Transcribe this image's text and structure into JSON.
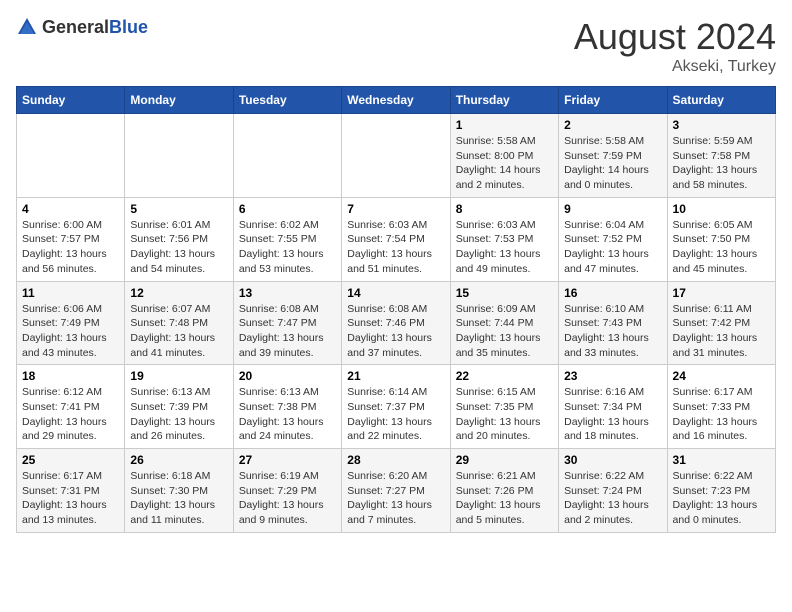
{
  "header": {
    "logo_general": "General",
    "logo_blue": "Blue",
    "main_title": "August 2024",
    "sub_title": "Akseki, Turkey"
  },
  "weekdays": [
    "Sunday",
    "Monday",
    "Tuesday",
    "Wednesday",
    "Thursday",
    "Friday",
    "Saturday"
  ],
  "weeks": [
    [
      {
        "day": "",
        "info": ""
      },
      {
        "day": "",
        "info": ""
      },
      {
        "day": "",
        "info": ""
      },
      {
        "day": "",
        "info": ""
      },
      {
        "day": "1",
        "info": "Sunrise: 5:58 AM\nSunset: 8:00 PM\nDaylight: 14 hours\nand 2 minutes."
      },
      {
        "day": "2",
        "info": "Sunrise: 5:58 AM\nSunset: 7:59 PM\nDaylight: 14 hours\nand 0 minutes."
      },
      {
        "day": "3",
        "info": "Sunrise: 5:59 AM\nSunset: 7:58 PM\nDaylight: 13 hours\nand 58 minutes."
      }
    ],
    [
      {
        "day": "4",
        "info": "Sunrise: 6:00 AM\nSunset: 7:57 PM\nDaylight: 13 hours\nand 56 minutes."
      },
      {
        "day": "5",
        "info": "Sunrise: 6:01 AM\nSunset: 7:56 PM\nDaylight: 13 hours\nand 54 minutes."
      },
      {
        "day": "6",
        "info": "Sunrise: 6:02 AM\nSunset: 7:55 PM\nDaylight: 13 hours\nand 53 minutes."
      },
      {
        "day": "7",
        "info": "Sunrise: 6:03 AM\nSunset: 7:54 PM\nDaylight: 13 hours\nand 51 minutes."
      },
      {
        "day": "8",
        "info": "Sunrise: 6:03 AM\nSunset: 7:53 PM\nDaylight: 13 hours\nand 49 minutes."
      },
      {
        "day": "9",
        "info": "Sunrise: 6:04 AM\nSunset: 7:52 PM\nDaylight: 13 hours\nand 47 minutes."
      },
      {
        "day": "10",
        "info": "Sunrise: 6:05 AM\nSunset: 7:50 PM\nDaylight: 13 hours\nand 45 minutes."
      }
    ],
    [
      {
        "day": "11",
        "info": "Sunrise: 6:06 AM\nSunset: 7:49 PM\nDaylight: 13 hours\nand 43 minutes."
      },
      {
        "day": "12",
        "info": "Sunrise: 6:07 AM\nSunset: 7:48 PM\nDaylight: 13 hours\nand 41 minutes."
      },
      {
        "day": "13",
        "info": "Sunrise: 6:08 AM\nSunset: 7:47 PM\nDaylight: 13 hours\nand 39 minutes."
      },
      {
        "day": "14",
        "info": "Sunrise: 6:08 AM\nSunset: 7:46 PM\nDaylight: 13 hours\nand 37 minutes."
      },
      {
        "day": "15",
        "info": "Sunrise: 6:09 AM\nSunset: 7:44 PM\nDaylight: 13 hours\nand 35 minutes."
      },
      {
        "day": "16",
        "info": "Sunrise: 6:10 AM\nSunset: 7:43 PM\nDaylight: 13 hours\nand 33 minutes."
      },
      {
        "day": "17",
        "info": "Sunrise: 6:11 AM\nSunset: 7:42 PM\nDaylight: 13 hours\nand 31 minutes."
      }
    ],
    [
      {
        "day": "18",
        "info": "Sunrise: 6:12 AM\nSunset: 7:41 PM\nDaylight: 13 hours\nand 29 minutes."
      },
      {
        "day": "19",
        "info": "Sunrise: 6:13 AM\nSunset: 7:39 PM\nDaylight: 13 hours\nand 26 minutes."
      },
      {
        "day": "20",
        "info": "Sunrise: 6:13 AM\nSunset: 7:38 PM\nDaylight: 13 hours\nand 24 minutes."
      },
      {
        "day": "21",
        "info": "Sunrise: 6:14 AM\nSunset: 7:37 PM\nDaylight: 13 hours\nand 22 minutes."
      },
      {
        "day": "22",
        "info": "Sunrise: 6:15 AM\nSunset: 7:35 PM\nDaylight: 13 hours\nand 20 minutes."
      },
      {
        "day": "23",
        "info": "Sunrise: 6:16 AM\nSunset: 7:34 PM\nDaylight: 13 hours\nand 18 minutes."
      },
      {
        "day": "24",
        "info": "Sunrise: 6:17 AM\nSunset: 7:33 PM\nDaylight: 13 hours\nand 16 minutes."
      }
    ],
    [
      {
        "day": "25",
        "info": "Sunrise: 6:17 AM\nSunset: 7:31 PM\nDaylight: 13 hours\nand 13 minutes."
      },
      {
        "day": "26",
        "info": "Sunrise: 6:18 AM\nSunset: 7:30 PM\nDaylight: 13 hours\nand 11 minutes."
      },
      {
        "day": "27",
        "info": "Sunrise: 6:19 AM\nSunset: 7:29 PM\nDaylight: 13 hours\nand 9 minutes."
      },
      {
        "day": "28",
        "info": "Sunrise: 6:20 AM\nSunset: 7:27 PM\nDaylight: 13 hours\nand 7 minutes."
      },
      {
        "day": "29",
        "info": "Sunrise: 6:21 AM\nSunset: 7:26 PM\nDaylight: 13 hours\nand 5 minutes."
      },
      {
        "day": "30",
        "info": "Sunrise: 6:22 AM\nSunset: 7:24 PM\nDaylight: 13 hours\nand 2 minutes."
      },
      {
        "day": "31",
        "info": "Sunrise: 6:22 AM\nSunset: 7:23 PM\nDaylight: 13 hours\nand 0 minutes."
      }
    ]
  ]
}
